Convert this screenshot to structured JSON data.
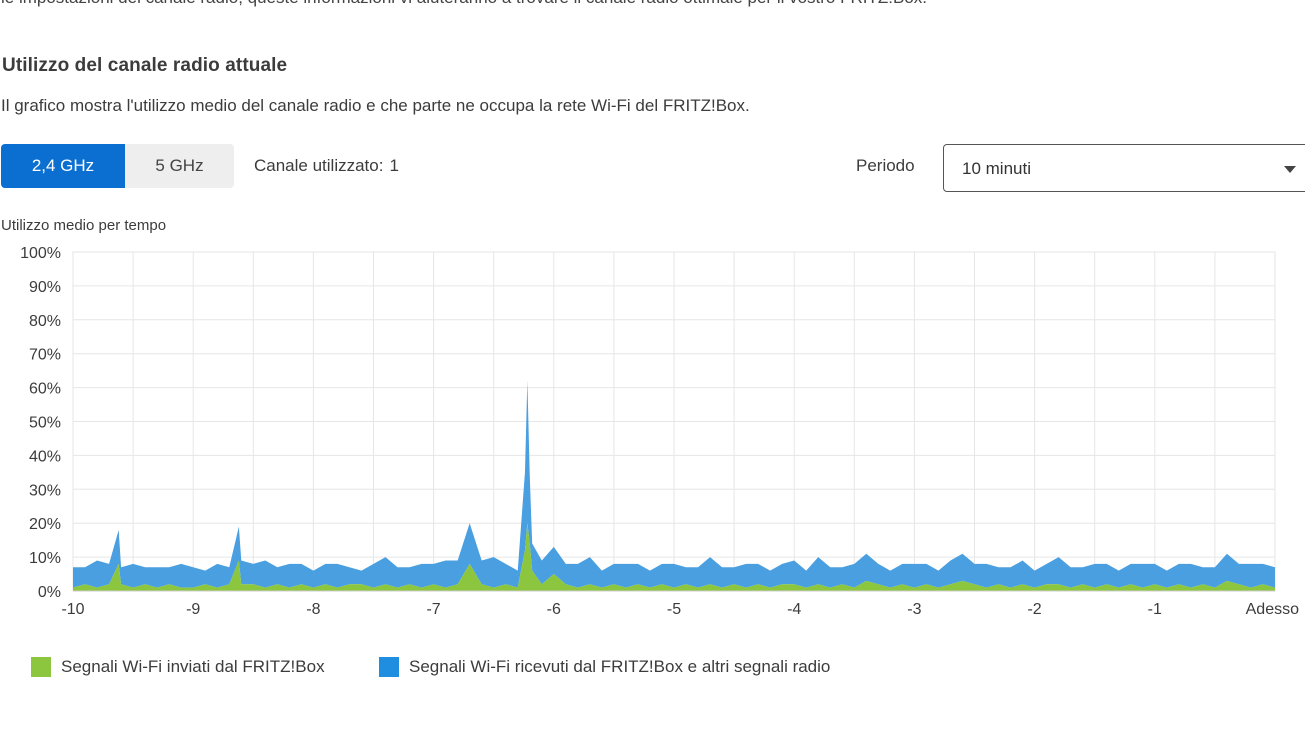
{
  "top_text": "le impostazioni del canale radio, queste informazioni vi aiuteranno a trovare il canale radio ottimale per il vostro FRITZ!Box.",
  "section": {
    "title": "Utilizzo del canale radio attuale",
    "description": "Il grafico mostra l'utilizzo medio del canale radio e che parte ne occupa la rete Wi-Fi del FRITZ!Box."
  },
  "band_tabs": [
    {
      "label": "2,4 GHz",
      "active": true
    },
    {
      "label": "5 GHz",
      "active": false
    }
  ],
  "channel": {
    "label": "Canale utilizzato:",
    "value": "1"
  },
  "period": {
    "label": "Periodo",
    "selected": "10 minuti"
  },
  "chart_caption": "Utilizzo medio per tempo",
  "colors": {
    "accent": "#0a6fd1",
    "wifi_sent": "#8cc63f",
    "wifi_received": "#4a9fe0",
    "grid": "#e6e6e6"
  },
  "chart_data": {
    "type": "area",
    "stacked": true,
    "title": "",
    "ylabel": "Utilizzo medio per tempo",
    "xlabel": "",
    "ylim": [
      0,
      100
    ],
    "xlim": [
      -10,
      0
    ],
    "grid": true,
    "y_ticks": [
      "0%",
      "10%",
      "20%",
      "30%",
      "40%",
      "50%",
      "60%",
      "70%",
      "80%",
      "90%",
      "100%"
    ],
    "x_ticks": [
      {
        "value": -10,
        "label": "-10"
      },
      {
        "value": -9,
        "label": "-9"
      },
      {
        "value": -8,
        "label": "-8"
      },
      {
        "value": -7,
        "label": "-7"
      },
      {
        "value": -6,
        "label": "-6"
      },
      {
        "value": -5,
        "label": "-5"
      },
      {
        "value": -4,
        "label": "-4"
      },
      {
        "value": -3,
        "label": "-3"
      },
      {
        "value": -2,
        "label": "-2"
      },
      {
        "value": -1,
        "label": "-1"
      },
      {
        "value": 0,
        "label": "Adesso"
      }
    ],
    "x": [
      -10,
      -9.9,
      -9.8,
      -9.7,
      -9.62,
      -9.6,
      -9.5,
      -9.4,
      -9.3,
      -9.2,
      -9.1,
      -9.0,
      -8.9,
      -8.8,
      -8.7,
      -8.62,
      -8.6,
      -8.5,
      -8.4,
      -8.3,
      -8.2,
      -8.1,
      -8.0,
      -7.9,
      -7.8,
      -7.7,
      -7.6,
      -7.5,
      -7.4,
      -7.3,
      -7.2,
      -7.1,
      -7.0,
      -6.9,
      -6.8,
      -6.7,
      -6.6,
      -6.5,
      -6.4,
      -6.3,
      -6.24,
      -6.22,
      -6.2,
      -6.18,
      -6.1,
      -6.0,
      -5.9,
      -5.8,
      -5.7,
      -5.6,
      -5.5,
      -5.4,
      -5.3,
      -5.2,
      -5.1,
      -5.0,
      -4.9,
      -4.8,
      -4.7,
      -4.6,
      -4.5,
      -4.4,
      -4.3,
      -4.2,
      -4.1,
      -4.0,
      -3.9,
      -3.8,
      -3.7,
      -3.6,
      -3.5,
      -3.4,
      -3.3,
      -3.2,
      -3.1,
      -3.0,
      -2.9,
      -2.8,
      -2.7,
      -2.6,
      -2.5,
      -2.4,
      -2.3,
      -2.2,
      -2.1,
      -2.0,
      -1.9,
      -1.8,
      -1.7,
      -1.6,
      -1.5,
      -1.4,
      -1.3,
      -1.2,
      -1.1,
      -1.0,
      -0.9,
      -0.8,
      -0.7,
      -0.6,
      -0.5,
      -0.4,
      -0.3,
      -0.2,
      -0.1,
      0
    ],
    "series": [
      {
        "name": "Segnali Wi-Fi inviati dal FRITZ!Box",
        "color": "#8cc63f",
        "values": [
          1,
          2,
          1,
          2,
          8,
          2,
          1,
          2,
          1,
          2,
          1,
          1,
          2,
          1,
          2,
          9,
          2,
          2,
          1,
          2,
          1,
          2,
          1,
          2,
          1,
          2,
          2,
          1,
          2,
          1,
          2,
          1,
          2,
          1,
          2,
          8,
          2,
          1,
          2,
          1,
          12,
          20,
          14,
          6,
          2,
          5,
          2,
          1,
          2,
          1,
          2,
          1,
          2,
          1,
          2,
          1,
          2,
          1,
          2,
          1,
          2,
          1,
          2,
          1,
          2,
          2,
          1,
          2,
          1,
          2,
          1,
          3,
          2,
          1,
          2,
          1,
          2,
          1,
          2,
          3,
          2,
          1,
          2,
          1,
          2,
          1,
          2,
          2,
          1,
          2,
          1,
          2,
          1,
          2,
          1,
          2,
          1,
          2,
          1,
          2,
          1,
          3,
          2,
          1,
          2,
          1
        ]
      },
      {
        "name": "Segnali Wi-Fi ricevuti dal FRITZ!Box e altri segnali radio",
        "color": "#4a9fe0",
        "values": [
          6,
          5,
          8,
          6,
          10,
          5,
          7,
          5,
          6,
          5,
          7,
          6,
          4,
          7,
          5,
          10,
          7,
          6,
          8,
          5,
          7,
          6,
          5,
          6,
          7,
          5,
          4,
          7,
          8,
          6,
          5,
          7,
          6,
          8,
          7,
          12,
          7,
          9,
          6,
          5,
          23,
          42,
          20,
          8,
          7,
          8,
          6,
          7,
          8,
          5,
          6,
          7,
          6,
          5,
          6,
          7,
          5,
          6,
          8,
          6,
          5,
          7,
          6,
          5,
          6,
          7,
          5,
          8,
          6,
          5,
          7,
          8,
          6,
          5,
          6,
          7,
          6,
          5,
          7,
          8,
          6,
          7,
          5,
          6,
          7,
          5,
          6,
          8,
          6,
          5,
          7,
          6,
          5,
          6,
          7,
          6,
          5,
          6,
          7,
          5,
          6,
          8,
          6,
          7,
          6,
          6
        ]
      }
    ]
  }
}
